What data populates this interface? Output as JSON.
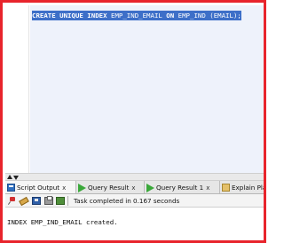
{
  "editor": {
    "sql": {
      "kw1": "CREATE UNIQUE INDEX",
      "name1": " EMP_IND_EMAIL ",
      "kw2": "ON",
      "rest": " EMP_IND (EMAIL);"
    }
  },
  "tabs": [
    {
      "label": "Script Output",
      "close": "x",
      "icon": "script-output-icon"
    },
    {
      "label": "Query Result",
      "close": "x",
      "icon": "play-icon"
    },
    {
      "label": "Query Result 1",
      "close": "x",
      "icon": "play-icon"
    },
    {
      "label": "Explain Pla",
      "close": "",
      "icon": "explain-plan-icon"
    }
  ],
  "toolbar": {
    "icons": [
      "pin-icon",
      "eraser-icon",
      "save-icon",
      "print-icon",
      "clear-icon"
    ],
    "status": "Task completed in 0.167 seconds"
  },
  "output": {
    "message": "INDEX EMP_IND_EMAIL created."
  },
  "colors": {
    "frame_border": "#e8242c",
    "selection": "#3d6fc8",
    "current_line": "#eef2fb"
  }
}
